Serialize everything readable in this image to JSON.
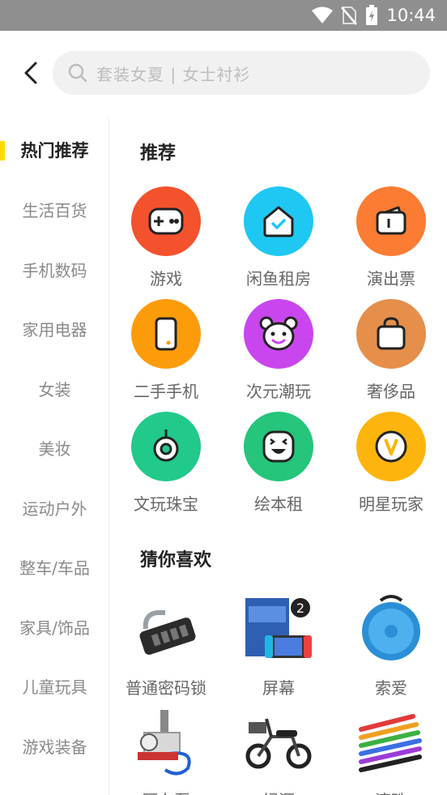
{
  "status_bar": {
    "time": "10:44"
  },
  "search": {
    "placeholder": "套装女夏 | 女士衬衫"
  },
  "sidebar": {
    "items": [
      {
        "label": "热门推荐",
        "active": true
      },
      {
        "label": "生活百货"
      },
      {
        "label": "手机数码"
      },
      {
        "label": "家用电器"
      },
      {
        "label": "女装"
      },
      {
        "label": "美妆"
      },
      {
        "label": "运动户外"
      },
      {
        "label": "整车/车品"
      },
      {
        "label": "家具/饰品"
      },
      {
        "label": "儿童玩具"
      },
      {
        "label": "游戏装备"
      }
    ]
  },
  "recommend": {
    "title": "推荐",
    "items": [
      {
        "label": "游戏",
        "icon": "gamepad-icon",
        "color": "#f4522d"
      },
      {
        "label": "闲鱼租房",
        "icon": "house-icon",
        "color": "#1ec8f2"
      },
      {
        "label": "演出票",
        "icon": "ticket-icon",
        "color": "#fb7c32"
      },
      {
        "label": "二手手机",
        "icon": "phone-icon",
        "color": "#fd9c0b"
      },
      {
        "label": "次元潮玩",
        "icon": "bear-icon",
        "color": "#c946ee"
      },
      {
        "label": "奢侈品",
        "icon": "bag-icon",
        "color": "#e58f4b"
      },
      {
        "label": "文玩珠宝",
        "icon": "ring-icon",
        "color": "#21c98b"
      },
      {
        "label": "绘本租",
        "icon": "smile-icon",
        "color": "#25c57b"
      },
      {
        "label": "明星玩家",
        "icon": "v-badge-icon",
        "color": "#fdb50d"
      }
    ]
  },
  "guess": {
    "title": "猜你喜欢",
    "items": [
      {
        "label": "普通密码锁",
        "icon": "lock-image"
      },
      {
        "label": "屏幕",
        "icon": "console-screen-image"
      },
      {
        "label": "索爱",
        "icon": "speaker-image"
      },
      {
        "label": "压力泵",
        "icon": "pump-image"
      },
      {
        "label": "绿源",
        "icon": "scooter-image"
      },
      {
        "label": "滚珠",
        "icon": "bead-bands-image"
      }
    ]
  }
}
